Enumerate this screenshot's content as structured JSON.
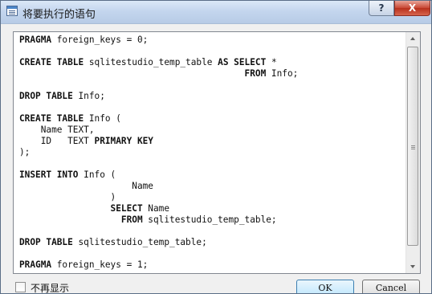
{
  "window": {
    "title": "将要执行的语句"
  },
  "titlebar_buttons": {
    "help": "?",
    "close": "X"
  },
  "editor": {
    "lines": [
      [
        {
          "t": "PRAGMA",
          "kw": true
        },
        {
          "t": " foreign_keys = 0;"
        }
      ],
      [],
      [
        {
          "t": "CREATE TABLE",
          "kw": true
        },
        {
          "t": " sqlitestudio_temp_table "
        },
        {
          "t": "AS SELECT",
          "kw": true
        },
        {
          "t": " *"
        }
      ],
      [
        {
          "t": "                                          "
        },
        {
          "t": "FROM",
          "kw": true
        },
        {
          "t": " Info;"
        }
      ],
      [],
      [
        {
          "t": "DROP TABLE",
          "kw": true
        },
        {
          "t": " Info;"
        }
      ],
      [],
      [
        {
          "t": "CREATE TABLE",
          "kw": true
        },
        {
          "t": " Info ("
        }
      ],
      [
        {
          "t": "    Name TEXT,"
        }
      ],
      [
        {
          "t": "    ID   TEXT "
        },
        {
          "t": "PRIMARY KEY",
          "kw": true
        }
      ],
      [
        {
          "t": ");"
        }
      ],
      [],
      [
        {
          "t": "INSERT INTO",
          "kw": true
        },
        {
          "t": " Info ("
        }
      ],
      [
        {
          "t": "                     Name"
        }
      ],
      [
        {
          "t": "                 )"
        }
      ],
      [
        {
          "t": "                 "
        },
        {
          "t": "SELECT",
          "kw": true
        },
        {
          "t": " Name"
        }
      ],
      [
        {
          "t": "                   "
        },
        {
          "t": "FROM",
          "kw": true
        },
        {
          "t": " sqlitestudio_temp_table;"
        }
      ],
      [],
      [
        {
          "t": "DROP TABLE",
          "kw": true
        },
        {
          "t": " sqlitestudio_temp_table;"
        }
      ],
      [],
      [
        {
          "t": "PRAGMA",
          "kw": true
        },
        {
          "t": " foreign_keys = 1;"
        }
      ]
    ]
  },
  "footer": {
    "checkbox_label": "不再显示",
    "ok_label": "OK",
    "cancel_label": "Cancel"
  }
}
